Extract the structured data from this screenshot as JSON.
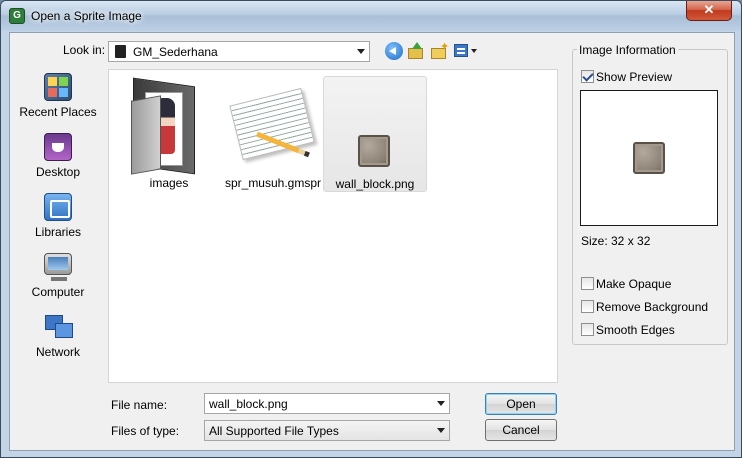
{
  "window": {
    "title": "Open a Sprite Image",
    "close_label": "✕"
  },
  "toolbar": {
    "look_in_label": "Look in:",
    "look_in_value": "GM_Sederhana",
    "icons": [
      "back-icon",
      "up-folder-icon",
      "new-folder-icon",
      "view-menu-icon"
    ]
  },
  "places": [
    {
      "label": "Recent Places",
      "icon": "recent-places-icon"
    },
    {
      "label": "Desktop",
      "icon": "desktop-icon"
    },
    {
      "label": "Libraries",
      "icon": "libraries-icon"
    },
    {
      "label": "Computer",
      "icon": "computer-icon"
    },
    {
      "label": "Network",
      "icon": "network-icon"
    }
  ],
  "files": [
    {
      "name": "images",
      "type": "folder",
      "selected": false
    },
    {
      "name": "spr_musuh.gmspr",
      "type": "document",
      "selected": false
    },
    {
      "name": "wall_block.png",
      "type": "image",
      "selected": true
    }
  ],
  "form": {
    "file_name_label": "File name:",
    "file_name_value": "wall_block.png",
    "file_type_label": "Files of type:",
    "file_type_value": "All Supported File Types",
    "open_label": "Open",
    "cancel_label": "Cancel"
  },
  "info": {
    "group_label": "Image Information",
    "show_preview_label": "Show Preview",
    "show_preview_checked": true,
    "size_text": "Size: 32 x 32",
    "make_opaque_label": "Make Opaque",
    "make_opaque_checked": false,
    "remove_background_label": "Remove Background",
    "remove_background_checked": false,
    "smooth_edges_label": "Smooth Edges",
    "smooth_edges_checked": false
  },
  "colors": {
    "title_gradient_top": "#d9e6f3",
    "close_button": "#c03a1f",
    "dialog_background": "#f0f0f0",
    "default_button_border": "#3c7fb1"
  }
}
